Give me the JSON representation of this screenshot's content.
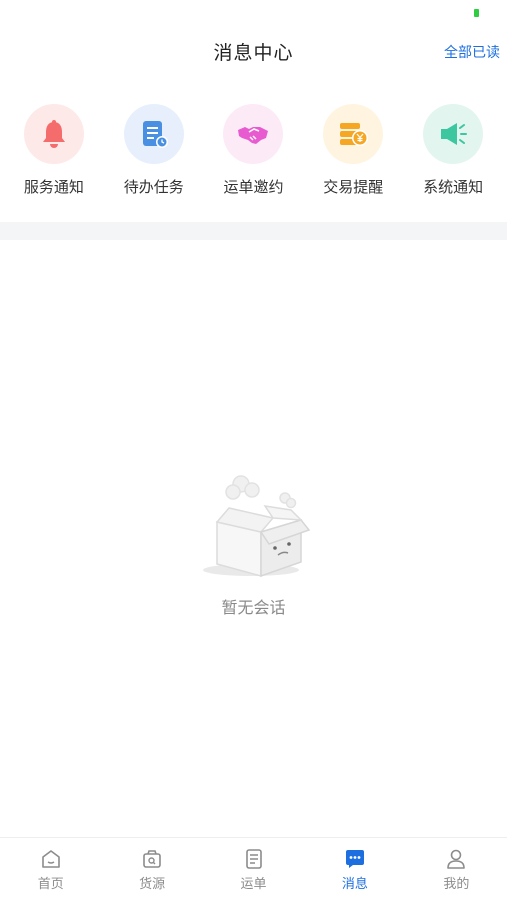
{
  "header": {
    "title": "消息中心",
    "mark_all_read": "全部已读"
  },
  "categories": [
    {
      "label": "服务通知",
      "icon": "bell-icon",
      "bg": "#fde9e8",
      "color": "#f56c6c"
    },
    {
      "label": "待办任务",
      "icon": "task-list-icon",
      "bg": "#e7effc",
      "color": "#4a90e2"
    },
    {
      "label": "运单邀约",
      "icon": "handshake-icon",
      "bg": "#fdeaf7",
      "color": "#e85bd0"
    },
    {
      "label": "交易提醒",
      "icon": "coins-icon",
      "bg": "#fff4e0",
      "color": "#f5a623"
    },
    {
      "label": "系统通知",
      "icon": "megaphone-icon",
      "bg": "#e2f5ef",
      "color": "#3cc7a0"
    }
  ],
  "empty_state": {
    "text": "暂无会话",
    "icon": "empty-box-icon"
  },
  "tabbar": {
    "active_color": "#1d6fe0",
    "items": [
      {
        "label": "首页",
        "icon": "home-icon",
        "active": false
      },
      {
        "label": "货源",
        "icon": "cargo-icon",
        "active": false
      },
      {
        "label": "运单",
        "icon": "waybill-icon",
        "active": false
      },
      {
        "label": "消息",
        "icon": "message-icon",
        "active": true
      },
      {
        "label": "我的",
        "icon": "profile-icon",
        "active": false
      }
    ]
  }
}
